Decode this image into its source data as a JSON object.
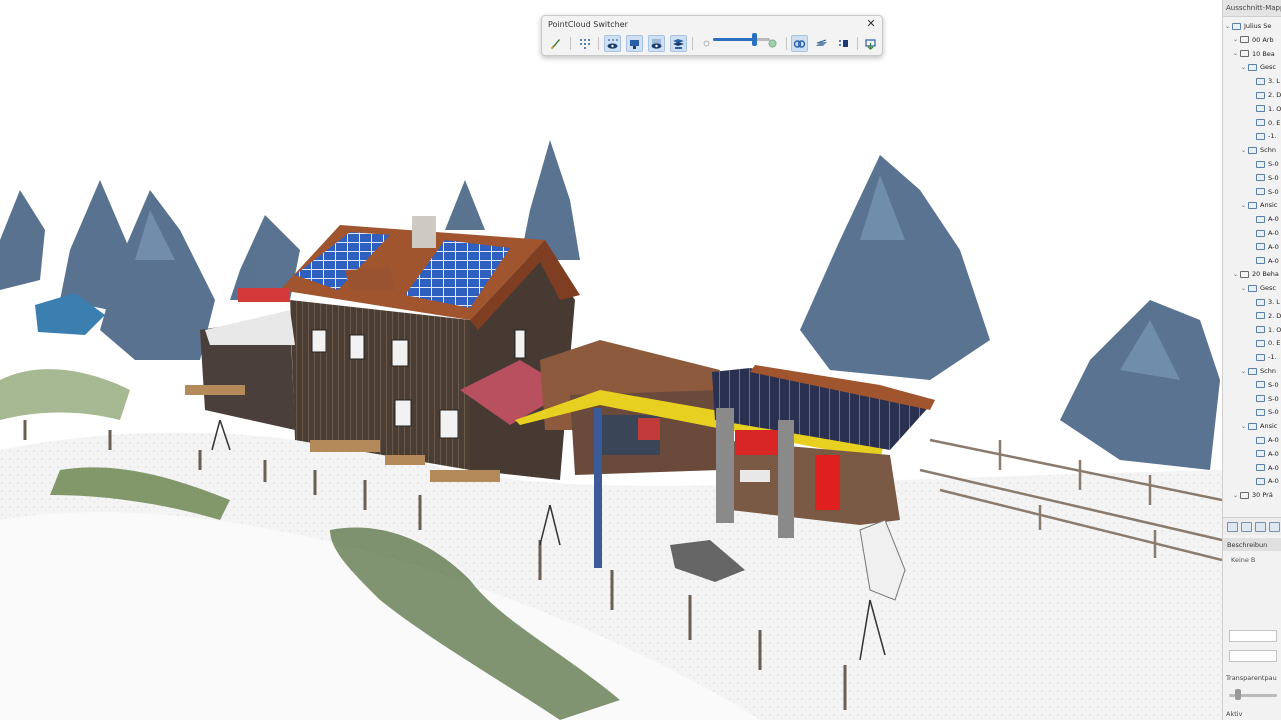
{
  "palette": {
    "title": "PointCloud Switcher",
    "close_glyph": "✕",
    "tools": [
      {
        "icon": "brush-icon",
        "active": false
      },
      {
        "icon": "points-grid-icon",
        "active": false
      },
      {
        "icon": "points-eye-icon",
        "active": true
      },
      {
        "icon": "camera-icon",
        "active": true
      },
      {
        "icon": "eye-icon",
        "active": true
      },
      {
        "icon": "layers-eye-icon",
        "active": true
      },
      {
        "icon": "cloud-link-icon",
        "active": true
      },
      {
        "icon": "surface-icon",
        "active": false
      },
      {
        "icon": "points-sort-icon",
        "active": false
      },
      {
        "icon": "export-icon",
        "active": false
      }
    ],
    "density_level": 0.72,
    "accent_color": "#2a6fc0"
  },
  "navigator": {
    "header": "Ausschnitt-Mappe",
    "tree": [
      {
        "label": "Julius Se",
        "level": 0,
        "type": "project"
      },
      {
        "label": "00 Arb",
        "level": 1,
        "type": "folder"
      },
      {
        "label": "10 Bea",
        "level": 1,
        "type": "folder"
      },
      {
        "label": "Gesc",
        "level": 2,
        "type": "view"
      },
      {
        "label": "3. L",
        "level": 3,
        "type": "view"
      },
      {
        "label": "2. D",
        "level": 3,
        "type": "view"
      },
      {
        "label": "1. O",
        "level": 3,
        "type": "view"
      },
      {
        "label": "0. E",
        "level": 3,
        "type": "view"
      },
      {
        "label": "-1.",
        "level": 3,
        "type": "view"
      },
      {
        "label": "Schn",
        "level": 2,
        "type": "view"
      },
      {
        "label": "S-0",
        "level": 3,
        "type": "view"
      },
      {
        "label": "S-0",
        "level": 3,
        "type": "view"
      },
      {
        "label": "S-0",
        "level": 3,
        "type": "view"
      },
      {
        "label": "Ansic",
        "level": 2,
        "type": "view"
      },
      {
        "label": "A-0",
        "level": 3,
        "type": "view"
      },
      {
        "label": "A-0",
        "level": 3,
        "type": "view"
      },
      {
        "label": "A-0",
        "level": 3,
        "type": "view"
      },
      {
        "label": "A-0",
        "level": 3,
        "type": "view"
      },
      {
        "label": "20 Beha",
        "level": 1,
        "type": "folder"
      },
      {
        "label": "Gesc",
        "level": 2,
        "type": "view"
      },
      {
        "label": "3. L",
        "level": 3,
        "type": "view"
      },
      {
        "label": "2. D",
        "level": 3,
        "type": "view"
      },
      {
        "label": "1. O",
        "level": 3,
        "type": "view"
      },
      {
        "label": "0. E",
        "level": 3,
        "type": "view"
      },
      {
        "label": "-1.",
        "level": 3,
        "type": "view"
      },
      {
        "label": "Schn",
        "level": 2,
        "type": "view"
      },
      {
        "label": "S-0",
        "level": 3,
        "type": "view"
      },
      {
        "label": "S-0",
        "level": 3,
        "type": "view"
      },
      {
        "label": "S-0",
        "level": 3,
        "type": "view"
      },
      {
        "label": "Ansic",
        "level": 2,
        "type": "view"
      },
      {
        "label": "A-0",
        "level": 3,
        "type": "view"
      },
      {
        "label": "A-0",
        "level": 3,
        "type": "view"
      },
      {
        "label": "A-0",
        "level": 3,
        "type": "view"
      },
      {
        "label": "A-0",
        "level": 3,
        "type": "view"
      },
      {
        "label": "30 Prä",
        "level": 1,
        "type": "folder"
      }
    ],
    "section_label": "Beschreibun",
    "description": "Keine B",
    "transparency_label": "Transparentpau",
    "bottom_label": "Aktiv"
  }
}
